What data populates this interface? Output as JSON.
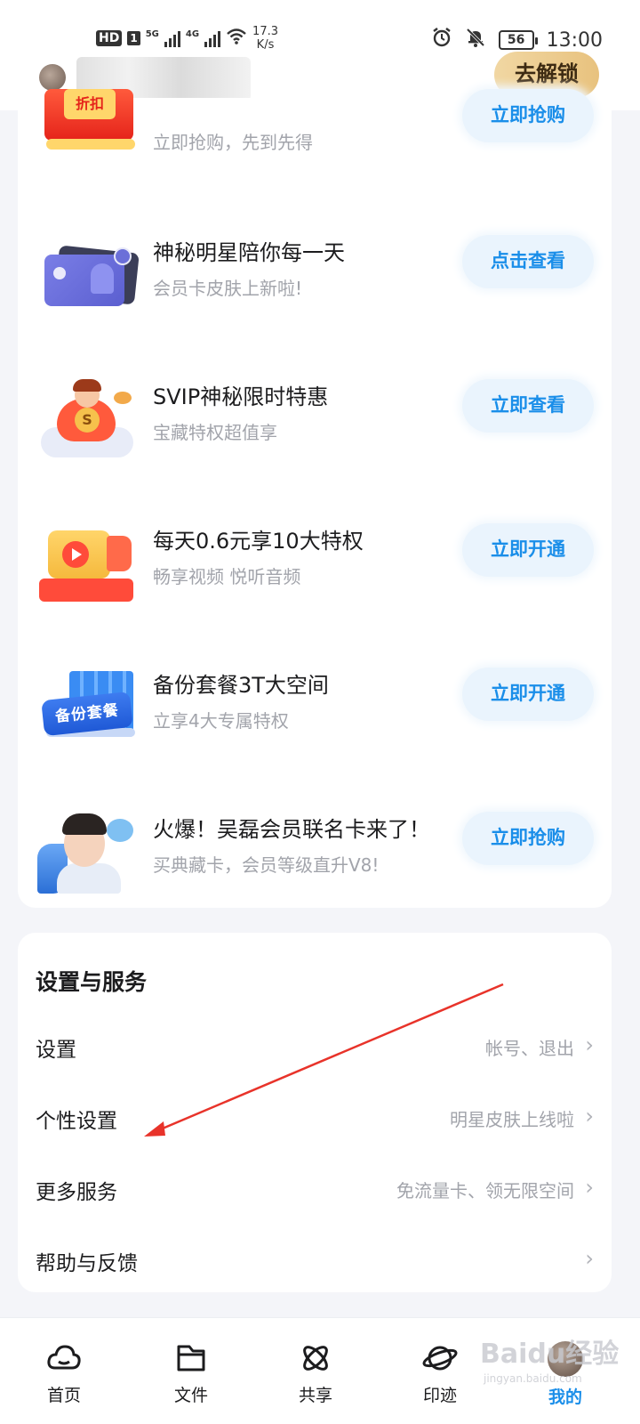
{
  "status_bar": {
    "hd": "HD",
    "sim": "1",
    "net1": "5G",
    "net2": "4G",
    "speed_value": "17.3",
    "speed_unit": "K/s",
    "battery": "56",
    "time": "13:00"
  },
  "header": {
    "unlock_label": "去解锁"
  },
  "promos": [
    {
      "title": "",
      "subtitle": "立即抢购，先到先得",
      "button": "立即抢购",
      "badge": "折扣"
    },
    {
      "title": "神秘明星陪你每一天",
      "subtitle": "会员卡皮肤上新啦!",
      "button": "点击查看"
    },
    {
      "title": "SVIP神秘限时特惠",
      "subtitle": "宝藏特权超值享",
      "button": "立即查看",
      "badge": "S"
    },
    {
      "title": "每天0.6元享10大特权",
      "subtitle": "畅享视频 悦听音频",
      "button": "立即开通"
    },
    {
      "title": "备份套餐3T大空间",
      "subtitle": "立享4大专属特权",
      "button": "立即开通",
      "badge": "备份套餐"
    },
    {
      "title": "火爆！吴磊会员联名卡来了！",
      "subtitle": "买典藏卡，会员等级直升V8!",
      "button": "立即抢购"
    }
  ],
  "settings": {
    "title": "设置与服务",
    "items": [
      {
        "label": "设置",
        "hint": "帐号、退出"
      },
      {
        "label": "个性设置",
        "hint": "明星皮肤上线啦"
      },
      {
        "label": "更多服务",
        "hint": "免流量卡、领无限空间"
      },
      {
        "label": "帮助与反馈",
        "hint": ""
      }
    ]
  },
  "nav": {
    "items": [
      {
        "label": "首页",
        "icon": "cloud-icon"
      },
      {
        "label": "文件",
        "icon": "folder-icon"
      },
      {
        "label": "共享",
        "icon": "share-atom-icon"
      },
      {
        "label": "印迹",
        "icon": "planet-icon"
      },
      {
        "label": "我的",
        "icon": "avatar"
      }
    ],
    "active_index": 4
  },
  "watermark": {
    "main": "Baidu经验",
    "sub": "jingyan.baidu.com"
  },
  "colors": {
    "accent": "#1a8ee9",
    "annotation_arrow": "#e8332a",
    "unlock_gold": "#e8c27e"
  }
}
